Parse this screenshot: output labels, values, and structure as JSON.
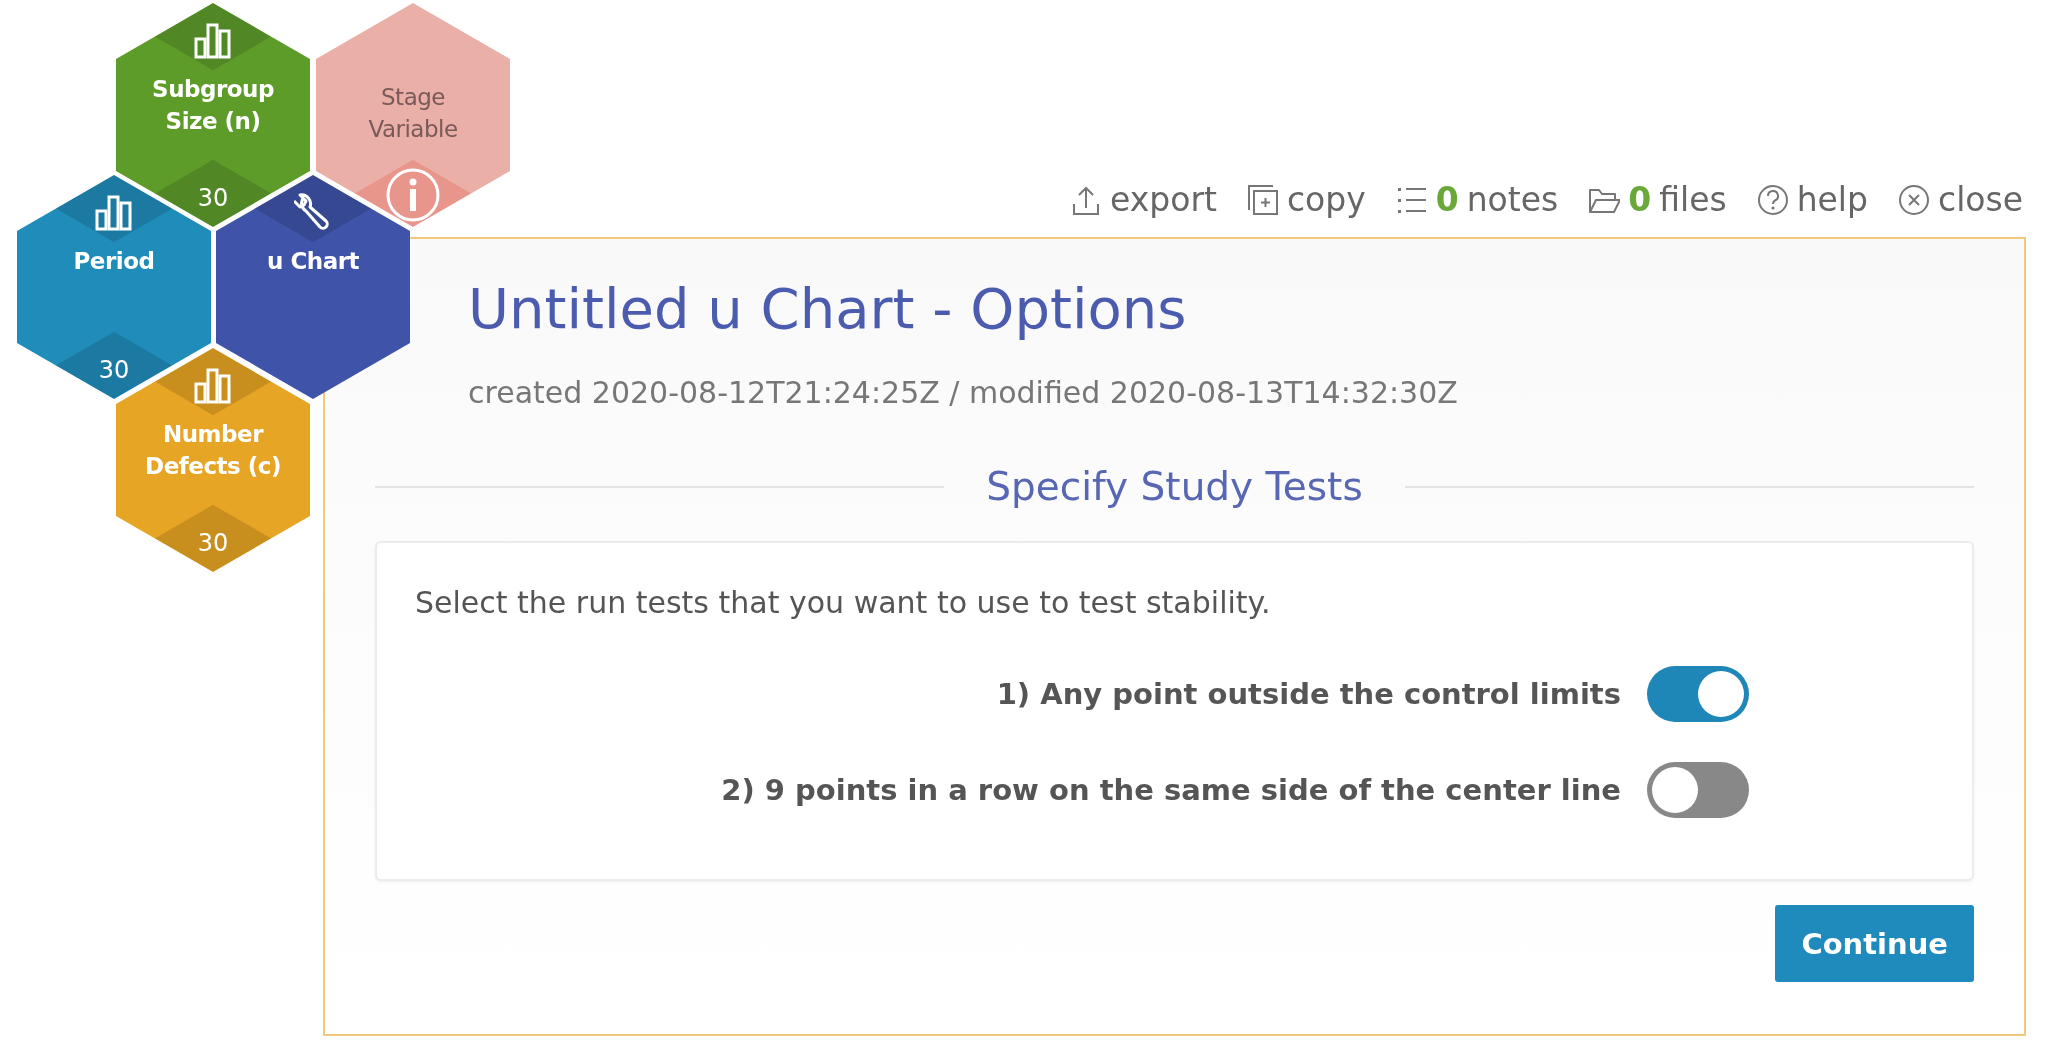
{
  "hexes": [
    {
      "label": "Subgroup Size (n)",
      "kind": "variable",
      "count": "30",
      "color": "#5e9c2a"
    },
    {
      "label": "Stage Variable",
      "kind": "optional",
      "color": "#eab0a8"
    },
    {
      "label": "Period",
      "kind": "variable",
      "count": "30",
      "color": "#1f8cba"
    },
    {
      "label": "u Chart",
      "kind": "chart",
      "color": "#3f53a8"
    },
    {
      "label": "Number Defects (c)",
      "kind": "variable",
      "count": "30",
      "color": "#e6a524"
    }
  ],
  "toolbar": [
    {
      "kind": "export",
      "label": "export"
    },
    {
      "kind": "copy",
      "label": "copy"
    },
    {
      "kind": "notes",
      "count": "0",
      "label": "notes"
    },
    {
      "kind": "files",
      "count": "0",
      "label": "files"
    },
    {
      "kind": "help",
      "label": "help"
    },
    {
      "kind": "close",
      "label": "close"
    }
  ],
  "title": "Untitled u Chart - Options",
  "timestamps": "created 2020-08-12T21:24:25Z / modified 2020-08-13T14:32:30Z",
  "section_heading": "Specify Study Tests",
  "instructions": "Select the run tests that you want to use to test stability.",
  "tests": [
    {
      "label": "1) Any point outside the control limits",
      "on": true
    },
    {
      "label": "2) 9 points in a row on the same side of the center line",
      "on": false
    }
  ],
  "continue_button": "Continue"
}
